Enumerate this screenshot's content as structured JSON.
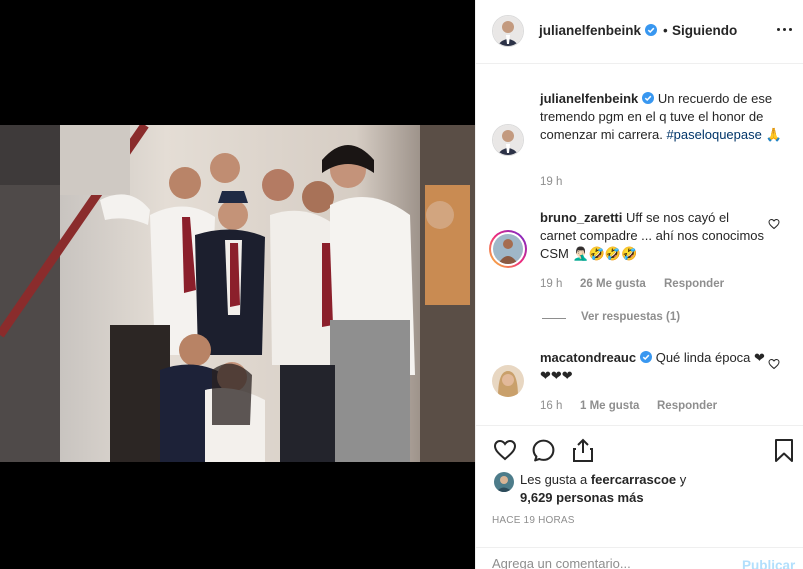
{
  "post": {
    "username": "julianelfenbeink",
    "separator": "•",
    "follow_status": "Siguiendo",
    "caption": "Un recuerdo de ese tremendo pgm en el q tuve el honor de comenzar mi carrera.",
    "hashtag": "#paseloquepase",
    "hashtag_suffix": "🙏",
    "caption_time": "19 h"
  },
  "comments": [
    {
      "username": "bruno_zaretti",
      "text": "Uff se nos cayó el carnet compadre ... ahí nos conocimos CSM 🤦🏻‍♂️🤣🤣🤣",
      "time": "19 h",
      "likes": "26 Me gusta",
      "reply": "Responder",
      "view_replies": "Ver respuestas (1)"
    },
    {
      "username": "macatondreauc",
      "text": "Qué linda época ❤❤❤❤",
      "time": "16 h",
      "likes": "1 Me gusta",
      "reply": "Responder"
    }
  ],
  "likes": {
    "line1": "Les gusta a",
    "liker": "feercarrascoe",
    "line2": "y",
    "count": "9,629 personas más"
  },
  "time_ago": "HACE 19 HORAS",
  "composer": {
    "placeholder": "Agrega un comentario...",
    "publish": "Publicar"
  },
  "icons": {
    "verified": "verified-badge-icon",
    "more": "more-options-icon",
    "like": "heart-icon",
    "comment": "comment-icon",
    "share": "share-icon",
    "save": "bookmark-icon"
  },
  "colors": {
    "verified": "#3897f0",
    "text": "#262626",
    "muted": "#8e8e8e",
    "hashtag": "#003569",
    "publish_disabled": "#b2dffc"
  }
}
